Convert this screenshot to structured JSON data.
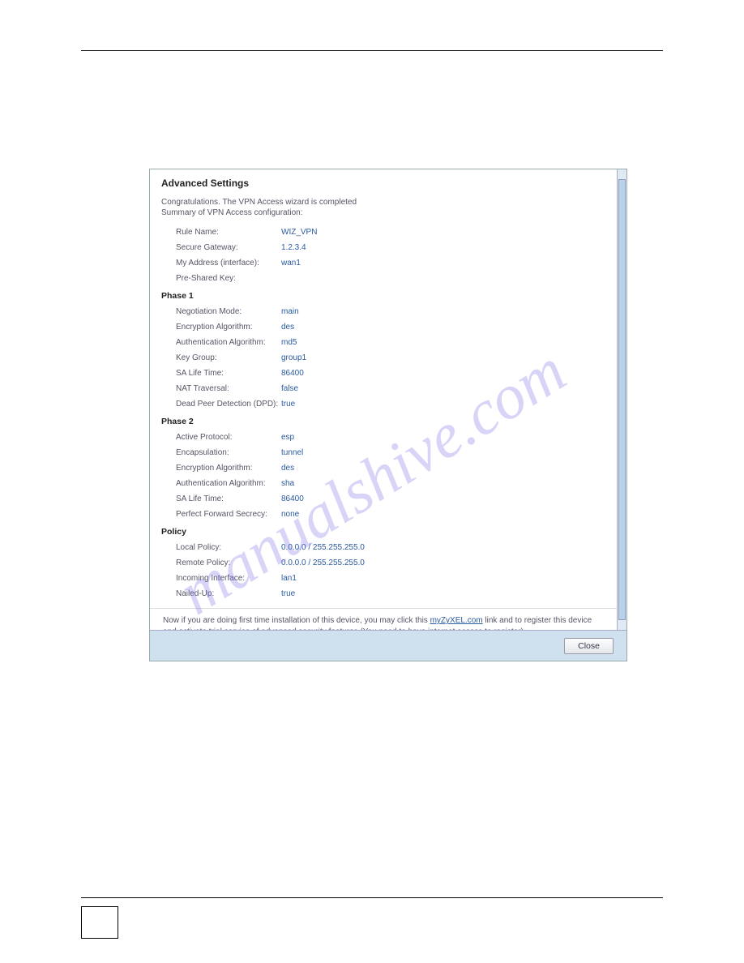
{
  "watermark": "manualshive.com",
  "panel": {
    "title": "Advanced Settings",
    "intro1": "Congratulations. The VPN Access wizard is completed",
    "intro2": "Summary of VPN Access configuration:",
    "top_fields": [
      {
        "label": "Rule Name:",
        "value": "WIZ_VPN"
      },
      {
        "label": "Secure Gateway:",
        "value": "1.2.3.4"
      },
      {
        "label": "My Address (interface):",
        "value": "wan1"
      },
      {
        "label": "Pre-Shared Key:",
        "value": ""
      }
    ],
    "phase1_head": "Phase 1",
    "phase1_fields": [
      {
        "label": "Negotiation Mode:",
        "value": "main"
      },
      {
        "label": "Encryption Algorithm:",
        "value": "des"
      },
      {
        "label": "Authentication Algorithm:",
        "value": "md5"
      },
      {
        "label": "Key Group:",
        "value": "group1"
      },
      {
        "label": "SA Life Time:",
        "value": "86400"
      },
      {
        "label": "NAT Traversal:",
        "value": "false"
      },
      {
        "label": "Dead Peer Detection (DPD):",
        "value": "true"
      }
    ],
    "phase2_head": "Phase 2",
    "phase2_fields": [
      {
        "label": "Active Protocol:",
        "value": "esp"
      },
      {
        "label": "Encapsulation:",
        "value": "tunnel"
      },
      {
        "label": "Encryption Algorithm:",
        "value": "des"
      },
      {
        "label": "Authentication Algorithm:",
        "value": "sha"
      },
      {
        "label": "SA Life Time:",
        "value": "86400"
      },
      {
        "label": "Perfect Forward Secrecy:",
        "value": "none"
      }
    ],
    "policy_head": "Policy",
    "policy_fields": [
      {
        "label": "Local Policy:",
        "value": "0.0.0.0 / 255.255.255.0"
      },
      {
        "label": "Remote Policy:",
        "value": "0.0.0.0 / 255.255.255.0"
      },
      {
        "label": "Incoming Interface:",
        "value": "lan1"
      },
      {
        "label": "Nailed-Up:",
        "value": "true"
      }
    ],
    "note_pre": "Now if you are doing first time installation of this device, you may click this",
    "note_link": "myZyXEL.com",
    "note_post": "link and to register this device and activate trial service of advanced security features.(You need to have internet access to register)",
    "close_btn": "Close"
  }
}
